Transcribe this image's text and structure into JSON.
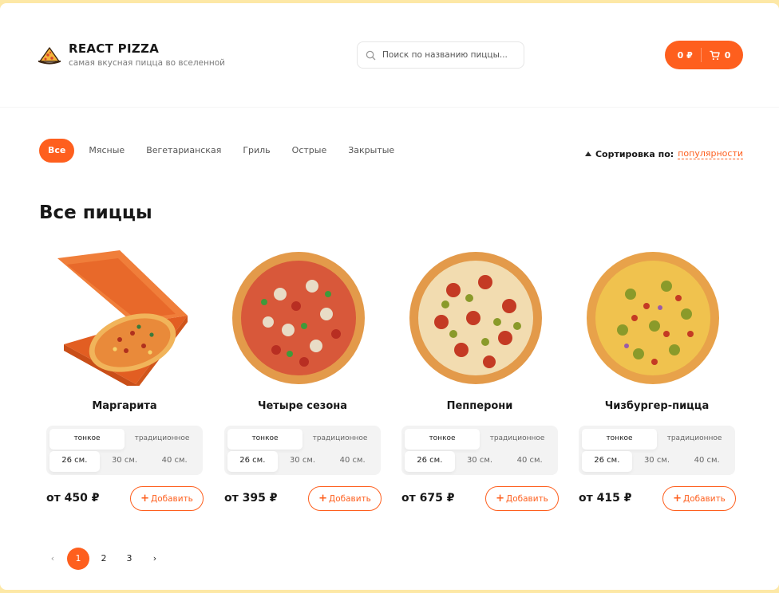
{
  "header": {
    "title": "REACT PIZZA",
    "subtitle": "самая вкусная пицца во вселенной",
    "search_placeholder": "Поиск по названию пиццы...",
    "cart_total": "0 ₽",
    "cart_count": "0"
  },
  "categories": [
    "Все",
    "Мясные",
    "Вегетарианская",
    "Гриль",
    "Острые",
    "Закрытые"
  ],
  "active_category": "Все",
  "sort": {
    "label": "Сортировка по:",
    "value": "популярности"
  },
  "page_title": "Все пиццы",
  "doughs": [
    "тонкое",
    "традиционное"
  ],
  "sizes": [
    "26 см.",
    "30 см.",
    "40 см."
  ],
  "add_label": "Добавить",
  "pizzas": [
    {
      "name": "Маргарита",
      "price": "от 450 ₽",
      "image": "pizza-in-box"
    },
    {
      "name": "Четыре сезона",
      "price": "от 395 ₽",
      "image": "pizza-mushrooms-peppers"
    },
    {
      "name": "Пепперони",
      "price": "от 675 ₽",
      "image": "pizza-pepperoni"
    },
    {
      "name": "Чизбургер-пицца",
      "price": "от 415 ₽",
      "image": "pizza-cheeseburger"
    }
  ],
  "pagination": {
    "pages": [
      "1",
      "2",
      "3"
    ],
    "current": "1",
    "prev": "‹",
    "next": "›"
  },
  "colors": {
    "accent": "#fe5f1e",
    "background": "#fde8a6"
  }
}
